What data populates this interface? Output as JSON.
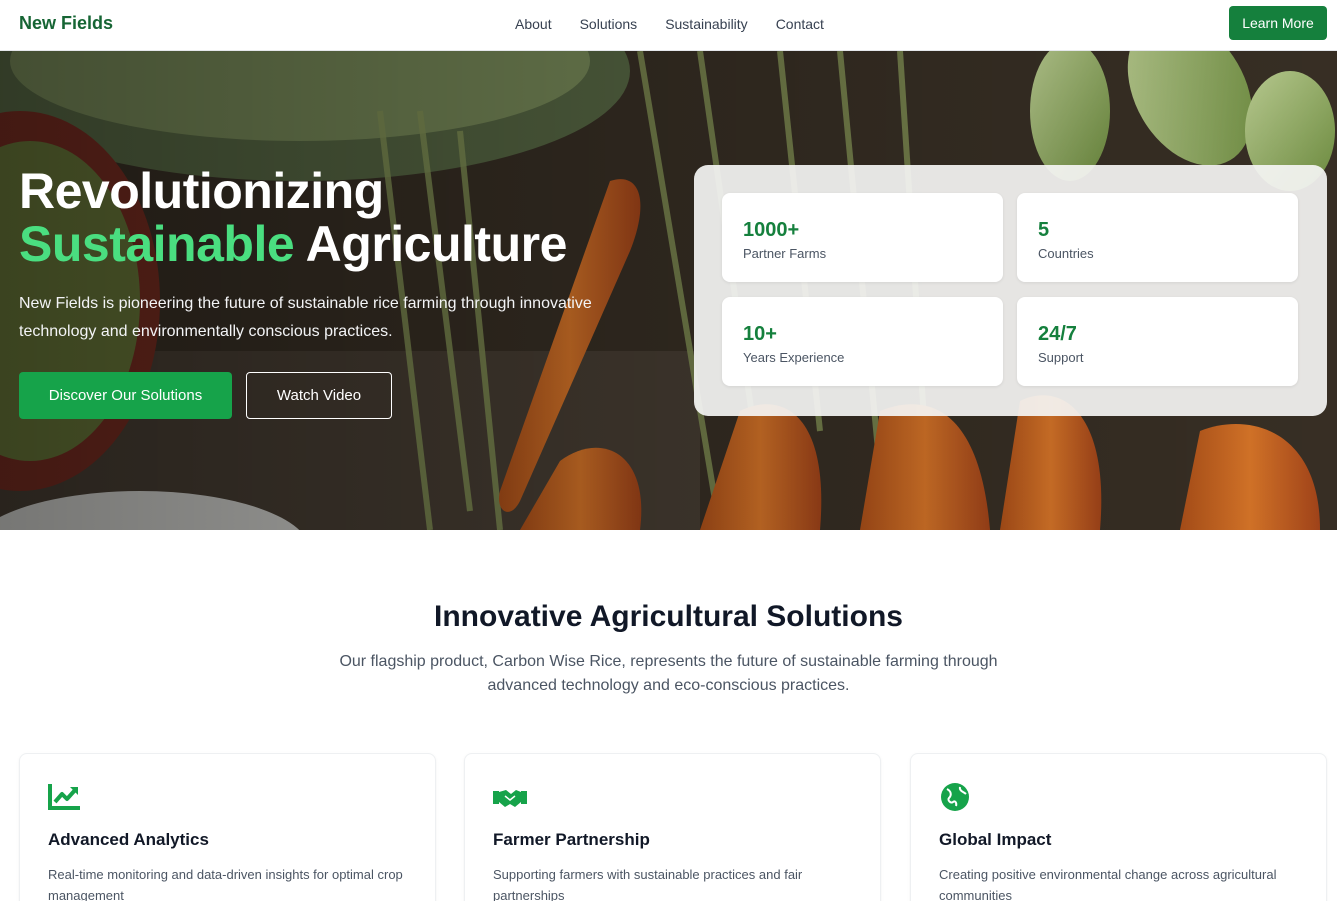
{
  "brand": "New Fields",
  "nav": {
    "links": [
      "About",
      "Solutions",
      "Sustainability",
      "Contact"
    ],
    "cta": "Learn More"
  },
  "hero": {
    "title_line1": "Revolutionizing",
    "title_accent": "Sustainable",
    "title_rest": " Agriculture",
    "subtitle": "New Fields is pioneering the future of sustainable rice farming through innovative technology and environmentally conscious practices.",
    "primary_button": "Discover Our Solutions",
    "secondary_button": "Watch Video",
    "stats": [
      {
        "value": "1000+",
        "label": "Partner Farms"
      },
      {
        "value": "5",
        "label": "Countries"
      },
      {
        "value": "10+",
        "label": "Years Experience"
      },
      {
        "value": "24/7",
        "label": "Support"
      }
    ]
  },
  "solutions": {
    "title": "Innovative Agricultural Solutions",
    "subtitle": "Our flagship product, Carbon Wise Rice, represents the future of sustainable farming through advanced technology and eco-conscious practices.",
    "cards": [
      {
        "icon": "chart-line-icon",
        "title": "Advanced Analytics",
        "desc": "Real-time monitoring and data-driven insights for optimal crop management"
      },
      {
        "icon": "handshake-icon",
        "title": "Farmer Partnership",
        "desc": "Supporting farmers with sustainable practices and fair partnerships"
      },
      {
        "icon": "globe-icon",
        "title": "Global Impact",
        "desc": "Creating positive environmental change across agricultural communities"
      }
    ]
  },
  "colors": {
    "brand_green": "#166534",
    "primary_green": "#16a34a",
    "accent_green": "#4ade80"
  }
}
